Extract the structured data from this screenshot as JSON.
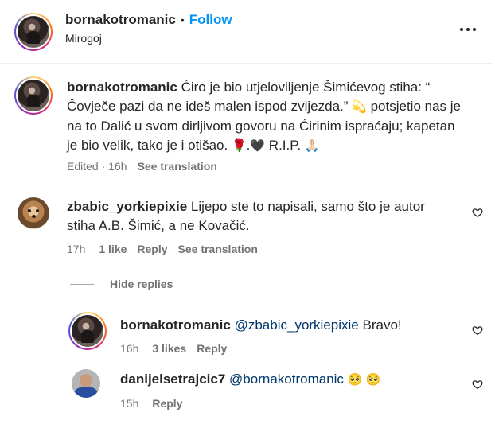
{
  "header": {
    "username": "bornakotromanic",
    "separator": "•",
    "follow_label": "Follow",
    "location": "Mirogoj"
  },
  "caption": {
    "username": "bornakotromanic",
    "text_part1": "Ćiro je bio utjeloviljenje Šimićevog stiha: “ Čovječe pazi da ne ideš malen ispod zvijezda.”",
    "emoji1": "💫",
    "text_part2": "potsjetio nas je na to Dalić u svom dirljivom govoru na Ćirinim ispraćaju; kapetan je bio velik, tako je i otišao.",
    "emoji2": "🌹",
    "text_dot": ".",
    "emoji3": "🖤",
    "text_rip": "R.I.P.",
    "emoji4": "🙏🏻",
    "edited": "Edited · 16h",
    "see_translation": "See translation"
  },
  "comment1": {
    "username": "zbabic_yorkiepixie",
    "text": "Lijepo ste to napisali, samo što je autor stiha A.B. Šimić, a ne Kovačić.",
    "time": "17h",
    "likes": "1 like",
    "reply": "Reply",
    "see_translation": "See translation"
  },
  "hide_replies": "Hide replies",
  "reply1": {
    "username": "bornakotromanic",
    "mention": "@zbabic_yorkiepixie",
    "text": "Bravo!",
    "time": "16h",
    "likes": "3 likes",
    "reply": "Reply"
  },
  "reply2": {
    "username": "danijelsetrajcic7",
    "mention": "@bornakotromanic",
    "emojis": "🥺 🥺",
    "time": "15h",
    "reply": "Reply"
  },
  "icons": {
    "more": "more-options-icon",
    "heart": "heart-outline-icon"
  }
}
